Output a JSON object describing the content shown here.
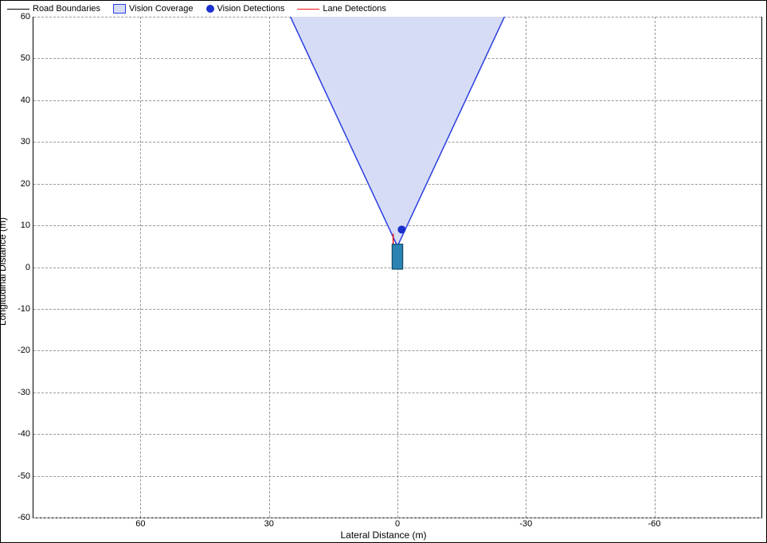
{
  "legend": {
    "road_boundaries": "Road Boundaries",
    "vision_coverage": "Vision Coverage",
    "vision_detections": "Vision Detections",
    "lane_detections": "Lane Detections"
  },
  "axes": {
    "xlabel": "Lateral Distance (m)",
    "ylabel": "Longitudinal Distance (m)"
  },
  "chart_data": {
    "type": "scatter",
    "title": "",
    "xlabel": "Lateral Distance (m)",
    "ylabel": "Longitudinal Distance (m)",
    "xlim": [
      85,
      -85
    ],
    "ylim": [
      -60,
      60
    ],
    "x_ticks": [
      60,
      30,
      0,
      -30,
      -60
    ],
    "y_ticks": [
      -60,
      -50,
      -40,
      -30,
      -20,
      -10,
      0,
      10,
      20,
      30,
      40,
      50,
      60
    ],
    "grid": true,
    "legend_position": "top",
    "series": [
      {
        "name": "Road Boundaries",
        "type": "line",
        "color": "#000000",
        "points": []
      },
      {
        "name": "Vision Coverage",
        "type": "polygon",
        "fill": "#d6dcf5",
        "stroke": "#2a3fe0",
        "vertices": [
          [
            0,
            5
          ],
          [
            25,
            60
          ],
          [
            -25,
            60
          ]
        ]
      },
      {
        "name": "Vision Detections",
        "type": "point",
        "color": "#1a2fcc",
        "points": [
          [
            -1,
            9
          ]
        ]
      },
      {
        "name": "Lane Detections",
        "type": "line",
        "color": "#ee1111",
        "points": [
          [
            1,
            2
          ],
          [
            1,
            8
          ]
        ]
      }
    ],
    "ego_vehicle": {
      "shape": "rect",
      "xy_center": [
        0,
        2.5
      ],
      "width": 2.5,
      "length": 6,
      "fill": "#2a83b3",
      "stroke": "#0b3a55"
    }
  }
}
